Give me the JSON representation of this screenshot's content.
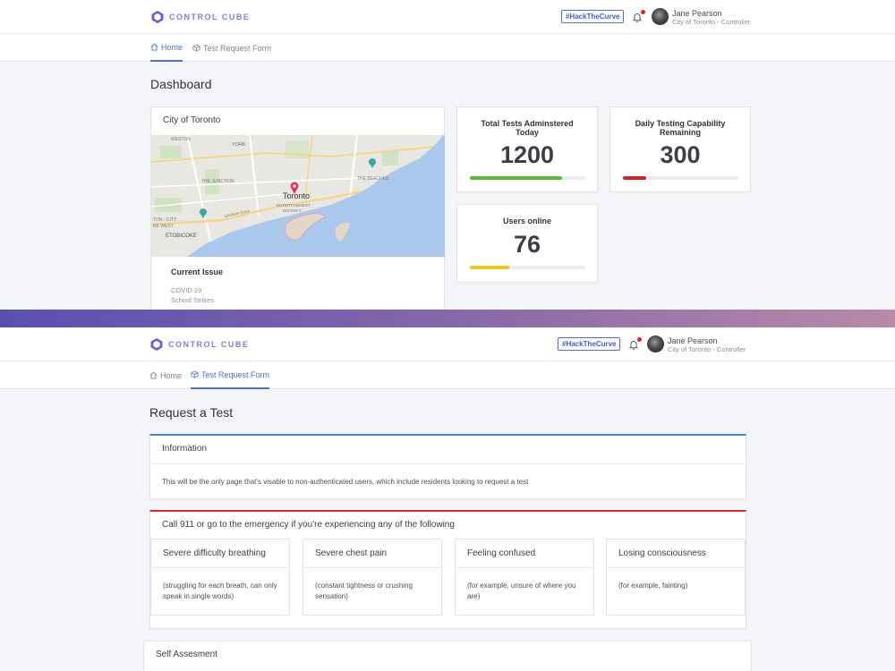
{
  "app": {
    "logo_text": "CONTROL CUBE",
    "hashtag": "#HackTheCurve",
    "user": {
      "name": "Jane Pearson",
      "role": "City of Toronto - Controller"
    },
    "tabs": {
      "home": "Home",
      "form": "Test Request Form"
    }
  },
  "dashboard": {
    "heading": "Dashboard",
    "map_card": {
      "title": "City of Toronto",
      "map_labels": {
        "weston": "WESTON",
        "york": "YORK",
        "junction": "THE JUNCTION",
        "toronto": "Toronto",
        "beaches": "THE BEACHES",
        "entertainment": "ENTERTAINMENT",
        "district": "DISTRICT",
        "toncity": "TON - CITY",
        "rewest": "RE WEST",
        "etobicoke": "ETOBICOKE",
        "gardiner": "Gardiner Expy"
      },
      "issue_title": "Current Issue",
      "issues": [
        "COVID 19",
        "School Strikes"
      ]
    },
    "stats": [
      {
        "title": "Total Tests Adminstered Today",
        "value": "1200",
        "fill_fraction": 0.8,
        "color": "#5cb82e"
      },
      {
        "title": "Daily Testing Capability Remaining",
        "value": "300",
        "fill_fraction": 0.2,
        "color": "#cc2229"
      },
      {
        "title": "Users online",
        "value": "76",
        "fill_fraction": 0.34,
        "color": "#f0c419"
      }
    ]
  },
  "request": {
    "heading": "Request a Test",
    "info": {
      "title": "Information",
      "body": "This will be the only page that's visable to non-authenticated users, which include residents looking to request a test"
    },
    "emergency": {
      "title": "Call 911 or go to the emergency if you're experiencing any of the following",
      "symptoms": [
        {
          "title": "Severe difficulty breathing",
          "desc": "(struggling for each breath, can only speak in single words)"
        },
        {
          "title": "Severe chest pain",
          "desc": "(constant tightness or crushing sensation)"
        },
        {
          "title": "Feeling confused",
          "desc": "(for example, unsure of where you are)"
        },
        {
          "title": "Losing consciousness",
          "desc": "(for example, fainting)"
        }
      ]
    },
    "self_assessment": {
      "title": "Self Assesment"
    }
  },
  "colors": {
    "accent": "#4a72c8",
    "info_border": "#4a7fd0",
    "emergency_border": "#d03030",
    "divider_start": "#5a4fb0",
    "divider_end": "#b88aa8"
  }
}
